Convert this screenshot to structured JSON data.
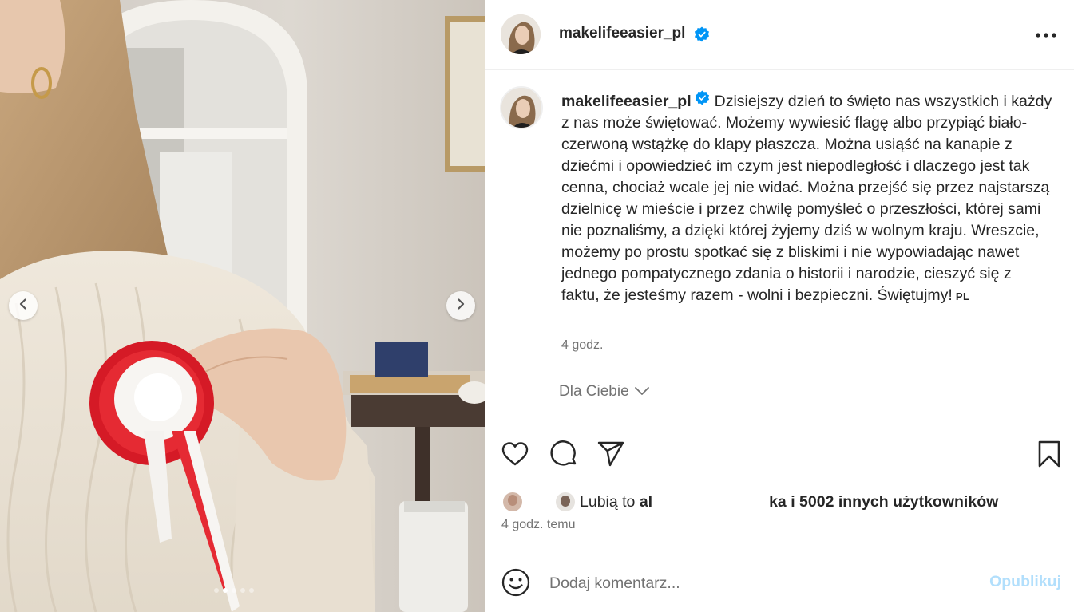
{
  "post": {
    "username": "makelifeeasier_pl",
    "verified": true,
    "caption": "Dzisiejszy dzień to święto nas wszystkich i każdy z nas może świętować. Możemy wywiesić flagę albo przypiąć biało-czerwoną wstążkę do klapy płaszcza. Można usiąść na kanapie z dziećmi i opowiedzieć im czym jest niepodległość i dlaczego jest tak cenna, chociaż wcale jej nie widać. Można przejść się przez najstarszą dzielnicę w mieście i przez chwilę pomyśleć o przeszłości, której sami nie poznaliśmy, a dzięki której żyjemy dziś w wolnym kraju. Wreszcie, możemy po prostu spotkać się z bliskimi i nie wypowiadając nawet jednego pompatycznego zdania o historii i narodzie, cieszyć się z faktu, że jesteśmy razem - wolni i bezpieczni. Świętujmy!",
    "caption_lang": "PL",
    "caption_time": "4 godz.",
    "for_you_label": "Dla Ciebie",
    "likes_prefix": "Lubią to ",
    "likes_user_start": "al",
    "likes_user_end": "ka",
    "likes_suffix": " i 5002 innych użytkowników",
    "posted_time": "4 godz. temu",
    "carousel": {
      "slides": 5,
      "active": 2
    }
  },
  "comment": {
    "placeholder": "Dodaj komentarz...",
    "publish_label": "Opublikuj"
  },
  "icons": {
    "more": "more-horizontal-icon",
    "like": "heart-icon",
    "comment": "comment-icon",
    "share": "send-icon",
    "save": "bookmark-icon",
    "emoji": "emoji-icon",
    "prev": "chevron-left-icon",
    "next": "chevron-right-icon",
    "verified": "verified-badge-icon"
  },
  "colors": {
    "verified": "#0095f6",
    "publish_disabled": "#b2dffc",
    "secondary_text": "#737373"
  }
}
